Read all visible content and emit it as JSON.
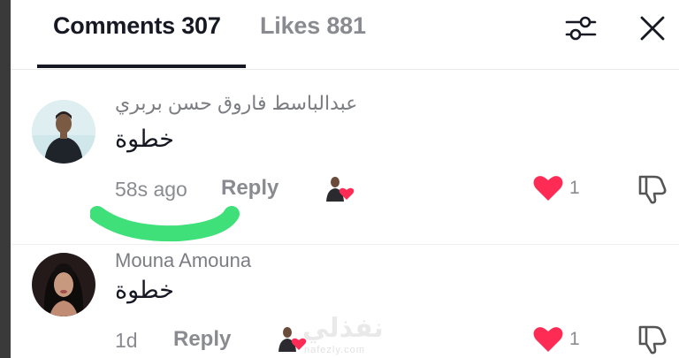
{
  "header": {
    "tabs": [
      {
        "label": "Comments 307"
      },
      {
        "label": "Likes 881"
      }
    ],
    "filter_icon": "sliders-icon",
    "close_icon": "close-icon"
  },
  "comments": [
    {
      "username": "عبدالباسط فاروق حسن بربري",
      "text": "خطوة",
      "time": "58s ago",
      "reply_label": "Reply",
      "likes": "1",
      "liked": true,
      "liked_by_creator": true
    },
    {
      "username": "Mouna Amouna",
      "text": "خطوة",
      "time": "1d",
      "reply_label": "Reply",
      "likes": "1",
      "liked": true,
      "liked_by_creator": true
    }
  ],
  "watermark": {
    "title": "نفذلي",
    "site": "nafezly.com"
  },
  "colors": {
    "heart": "#fe2c55",
    "highlight": "#3fe07a",
    "text": "#161823",
    "muted": "#8a8b91"
  }
}
